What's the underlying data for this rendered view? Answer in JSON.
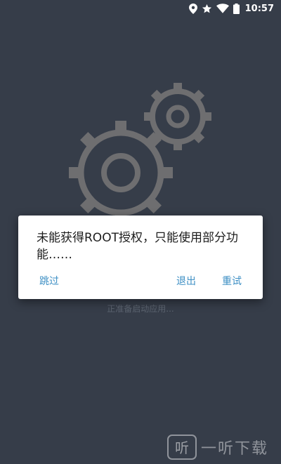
{
  "status_bar": {
    "time": "10:57",
    "icons": [
      "location-icon",
      "star-icon",
      "wifi-icon",
      "battery-icon"
    ]
  },
  "background": {
    "color": "#363d49",
    "illustration": "gears-icon",
    "loading_text": "正准备启动应用..."
  },
  "dialog": {
    "message": "未能获得ROOT授权，只能使用部分功能……",
    "buttons": {
      "skip": "跳过",
      "exit": "退出",
      "retry": "重试"
    },
    "button_color": "#3d8fc4"
  },
  "watermark": {
    "logo_text": "听",
    "text": "一听下载"
  }
}
